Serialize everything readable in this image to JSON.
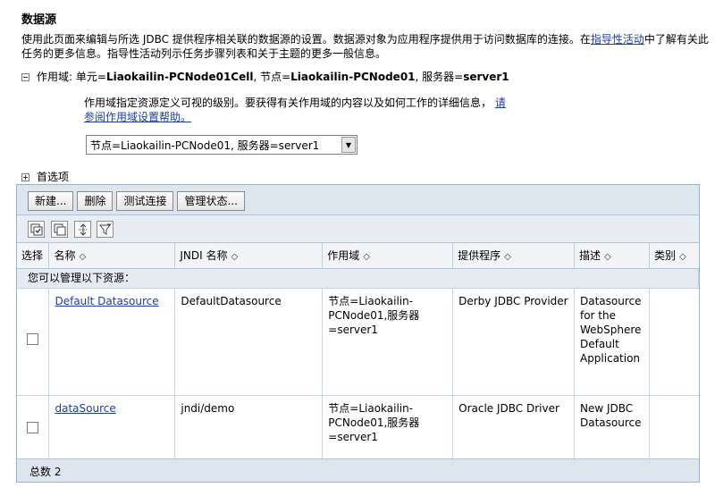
{
  "page": {
    "title": "数据源",
    "intro_text": "使用此页面来编辑与所选 JDBC 提供程序相关联的数据源的设置。数据源对象为应用程序提供用于访问数据库的连接。在",
    "intro_link": "指导性活动",
    "intro_text2": "中了解有关此任务的更多信息。指导性活动列示任务步骤列表和关于主题的更多一般信息。"
  },
  "scope": {
    "label": "作用域:",
    "cell_label": "单元=",
    "cell_value": "Liaokailin-PCNode01Cell",
    "node_label": ", 节点=",
    "node_value": "Liaokailin-PCNode01",
    "server_label": ", 服务器=",
    "server_value": "server1",
    "help_text": "作用域指定资源定义可视的级别。要获得有关作用域的内容以及如何工作的详细信息，",
    "help_link": "请参阅作用域设置帮助。",
    "selected": "节点=Liaokailin-PCNode01, 服务器=server1"
  },
  "preferences": {
    "label": "首选项"
  },
  "toolbar": {
    "new_label": "新建...",
    "delete_label": "删除",
    "test_label": "测试连接",
    "manage_label": "管理状态..."
  },
  "icons": [
    "select-all-icon",
    "deselect-all-icon",
    "expand-collapse-icon",
    "filter-icon"
  ],
  "table": {
    "headers": {
      "select": "选择",
      "name": "名称",
      "jndi": "JNDI 名称",
      "scope": "作用域",
      "provider": "提供程序",
      "desc": "描述",
      "category": "类别"
    },
    "sort_glyph": "◇",
    "group_label": "您可以管理以下资源：",
    "rows": [
      {
        "name": "Default Datasource",
        "jndi": "DefaultDatasource",
        "scope": "节点=Liaokailin-PCNode01,服务器=server1",
        "provider": "Derby JDBC Provider",
        "desc": "Datasource for the WebSphere Default Application",
        "category": ""
      },
      {
        "name": "dataSource",
        "jndi": "jndi/demo",
        "scope": "节点=Liaokailin-PCNode01,服务器=server1",
        "provider": "Oracle JDBC Driver",
        "desc": "New JDBC Datasource",
        "category": ""
      }
    ],
    "total_label": "总数 2"
  }
}
